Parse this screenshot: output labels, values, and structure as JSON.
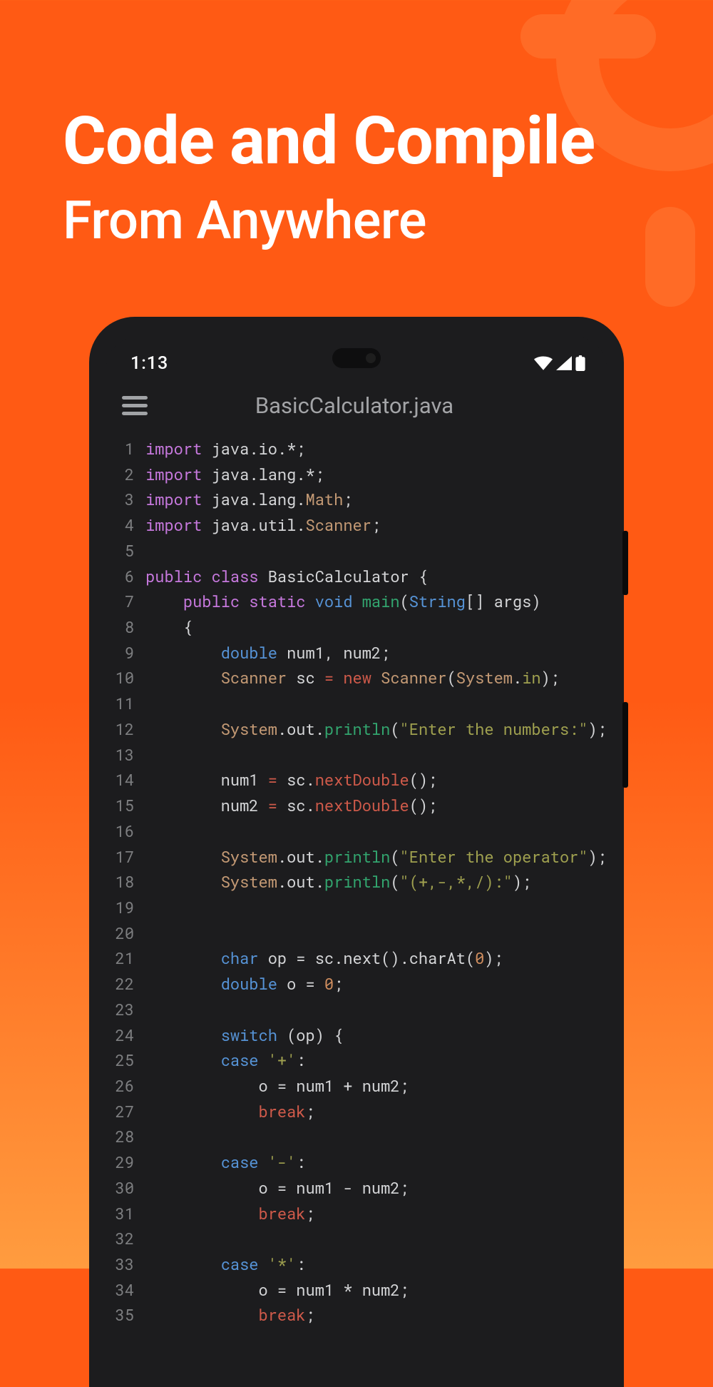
{
  "hero": {
    "headline": "Code and Compile",
    "subhead": "From Anywhere"
  },
  "statusBar": {
    "time": "1:13"
  },
  "appHeader": {
    "fileName": "BasicCalculator.java"
  },
  "code": {
    "lines": [
      [
        {
          "t": "kw",
          "v": "import"
        },
        {
          "t": "id",
          "v": " java.io.*;"
        }
      ],
      [
        {
          "t": "kw",
          "v": "import"
        },
        {
          "t": "id",
          "v": " java.lang.*;"
        }
      ],
      [
        {
          "t": "kw",
          "v": "import"
        },
        {
          "t": "id",
          "v": " java.lang."
        },
        {
          "t": "class",
          "v": "Math"
        },
        {
          "t": "id",
          "v": ";"
        }
      ],
      [
        {
          "t": "kw",
          "v": "import"
        },
        {
          "t": "id",
          "v": " java.util."
        },
        {
          "t": "class",
          "v": "Scanner"
        },
        {
          "t": "id",
          "v": ";"
        }
      ],
      [],
      [
        {
          "t": "kw",
          "v": "public"
        },
        {
          "t": "id",
          "v": " "
        },
        {
          "t": "kw",
          "v": "class"
        },
        {
          "t": "id",
          "v": " BasicCalculator {"
        }
      ],
      [
        {
          "t": "id",
          "v": "    "
        },
        {
          "t": "kw",
          "v": "public"
        },
        {
          "t": "id",
          "v": " "
        },
        {
          "t": "kw",
          "v": "static"
        },
        {
          "t": "id",
          "v": " "
        },
        {
          "t": "type",
          "v": "void"
        },
        {
          "t": "id",
          "v": " "
        },
        {
          "t": "fn",
          "v": "main"
        },
        {
          "t": "id",
          "v": "("
        },
        {
          "t": "type",
          "v": "String"
        },
        {
          "t": "id",
          "v": "[] args)"
        }
      ],
      [
        {
          "t": "id",
          "v": "    {"
        }
      ],
      [
        {
          "t": "id",
          "v": "        "
        },
        {
          "t": "type",
          "v": "double"
        },
        {
          "t": "id",
          "v": " num1, num2;"
        }
      ],
      [
        {
          "t": "id",
          "v": "        "
        },
        {
          "t": "class",
          "v": "Scanner"
        },
        {
          "t": "id",
          "v": " sc "
        },
        {
          "t": "new",
          "v": "="
        },
        {
          "t": "id",
          "v": " "
        },
        {
          "t": "new",
          "v": "new"
        },
        {
          "t": "id",
          "v": " "
        },
        {
          "t": "class",
          "v": "Scanner"
        },
        {
          "t": "id",
          "v": "("
        },
        {
          "t": "class",
          "v": "System"
        },
        {
          "t": "id",
          "v": "."
        },
        {
          "t": "str",
          "v": "in"
        },
        {
          "t": "id",
          "v": ");"
        }
      ],
      [],
      [
        {
          "t": "id",
          "v": "        "
        },
        {
          "t": "class",
          "v": "System"
        },
        {
          "t": "id",
          "v": ".out."
        },
        {
          "t": "fn",
          "v": "println"
        },
        {
          "t": "id",
          "v": "("
        },
        {
          "t": "str",
          "v": "\"Enter the numbers:\""
        },
        {
          "t": "id",
          "v": ");"
        }
      ],
      [],
      [
        {
          "t": "id",
          "v": "        num1 "
        },
        {
          "t": "new",
          "v": "="
        },
        {
          "t": "id",
          "v": " sc."
        },
        {
          "t": "fn2",
          "v": "nextDouble"
        },
        {
          "t": "id",
          "v": "();"
        }
      ],
      [
        {
          "t": "id",
          "v": "        num2 "
        },
        {
          "t": "new",
          "v": "="
        },
        {
          "t": "id",
          "v": " sc."
        },
        {
          "t": "fn2",
          "v": "nextDouble"
        },
        {
          "t": "id",
          "v": "();"
        }
      ],
      [],
      [
        {
          "t": "id",
          "v": "        "
        },
        {
          "t": "class",
          "v": "System"
        },
        {
          "t": "id",
          "v": ".out."
        },
        {
          "t": "fn",
          "v": "println"
        },
        {
          "t": "id",
          "v": "("
        },
        {
          "t": "str",
          "v": "\"Enter the operator\""
        },
        {
          "t": "id",
          "v": ");"
        }
      ],
      [
        {
          "t": "id",
          "v": "        "
        },
        {
          "t": "class",
          "v": "System"
        },
        {
          "t": "id",
          "v": ".out."
        },
        {
          "t": "fn",
          "v": "println"
        },
        {
          "t": "id",
          "v": "("
        },
        {
          "t": "str",
          "v": "\"(+,-,*,/):\""
        },
        {
          "t": "id",
          "v": ");"
        }
      ],
      [],
      [],
      [
        {
          "t": "id",
          "v": "        "
        },
        {
          "t": "type",
          "v": "char"
        },
        {
          "t": "id",
          "v": " op = sc.next().charAt("
        },
        {
          "t": "num",
          "v": "0"
        },
        {
          "t": "id",
          "v": ");"
        }
      ],
      [
        {
          "t": "id",
          "v": "        "
        },
        {
          "t": "type",
          "v": "double"
        },
        {
          "t": "id",
          "v": " o = "
        },
        {
          "t": "num",
          "v": "0"
        },
        {
          "t": "id",
          "v": ";"
        }
      ],
      [],
      [
        {
          "t": "id",
          "v": "        "
        },
        {
          "t": "blue",
          "v": "switch"
        },
        {
          "t": "id",
          "v": " (op) {"
        }
      ],
      [
        {
          "t": "id",
          "v": "        "
        },
        {
          "t": "blue",
          "v": "case"
        },
        {
          "t": "id",
          "v": " "
        },
        {
          "t": "str",
          "v": "'+'"
        },
        {
          "t": "id",
          "v": ":"
        }
      ],
      [
        {
          "t": "id",
          "v": "            o = num1 + num2;"
        }
      ],
      [
        {
          "t": "id",
          "v": "            "
        },
        {
          "t": "break",
          "v": "break"
        },
        {
          "t": "id",
          "v": ";"
        }
      ],
      [],
      [
        {
          "t": "id",
          "v": "        "
        },
        {
          "t": "blue",
          "v": "case"
        },
        {
          "t": "id",
          "v": " "
        },
        {
          "t": "str",
          "v": "'-'"
        },
        {
          "t": "id",
          "v": ":"
        }
      ],
      [
        {
          "t": "id",
          "v": "            o = num1 - num2;"
        }
      ],
      [
        {
          "t": "id",
          "v": "            "
        },
        {
          "t": "break",
          "v": "break"
        },
        {
          "t": "id",
          "v": ";"
        }
      ],
      [],
      [
        {
          "t": "id",
          "v": "        "
        },
        {
          "t": "blue",
          "v": "case"
        },
        {
          "t": "id",
          "v": " "
        },
        {
          "t": "str",
          "v": "'*'"
        },
        {
          "t": "id",
          "v": ":"
        }
      ],
      [
        {
          "t": "id",
          "v": "            o = num1 * num2;"
        }
      ],
      [
        {
          "t": "id",
          "v": "            "
        },
        {
          "t": "break",
          "v": "break"
        },
        {
          "t": "id",
          "v": ";"
        }
      ]
    ]
  }
}
